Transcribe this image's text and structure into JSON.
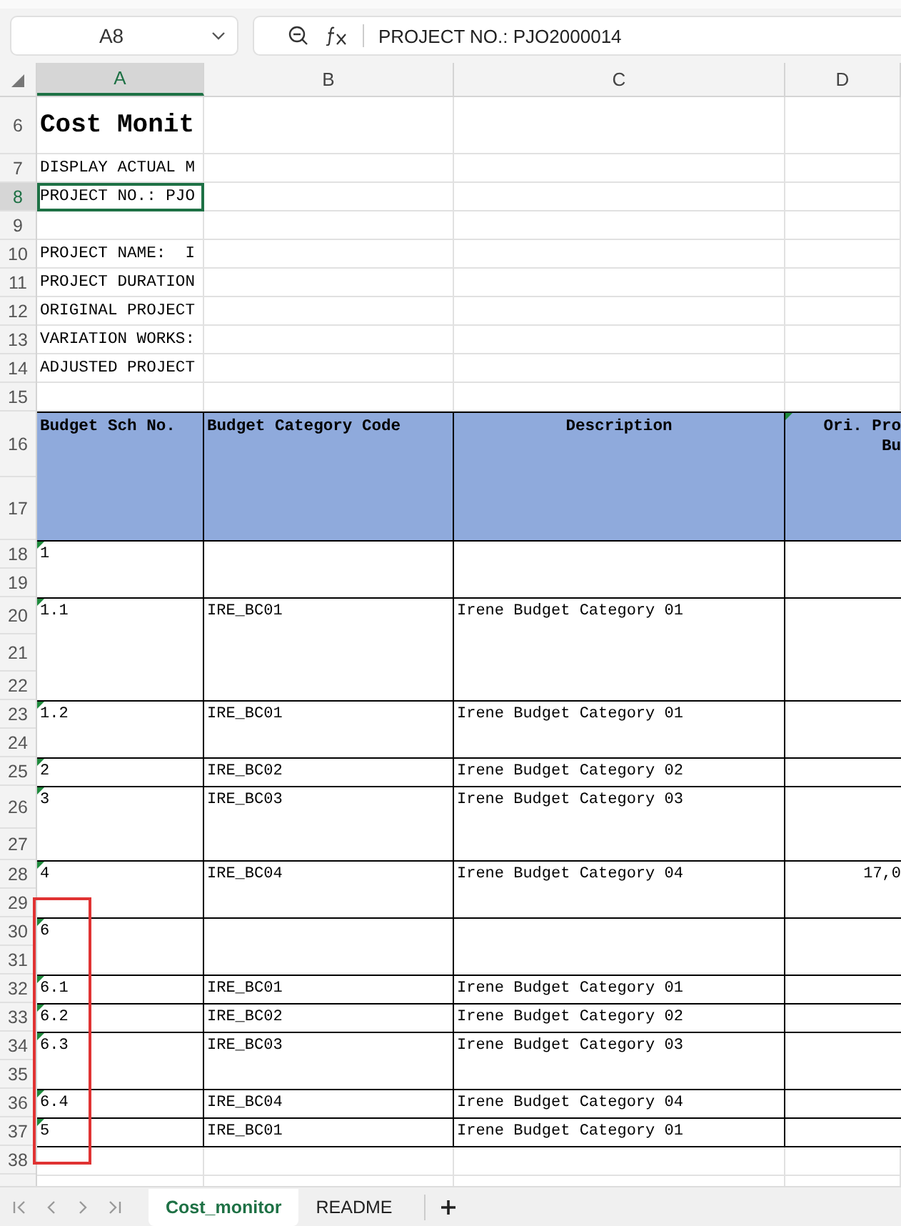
{
  "name_box": {
    "value": "A8"
  },
  "formula_bar": {
    "formula": "PROJECT NO.: PJO2000014"
  },
  "columns": [
    {
      "label": "A",
      "selected": true
    },
    {
      "label": "B",
      "selected": false
    },
    {
      "label": "C",
      "selected": false
    },
    {
      "label": "D",
      "selected": false
    }
  ],
  "row_headers": [
    {
      "label": "6",
      "selected": false
    },
    {
      "label": "7",
      "selected": false
    },
    {
      "label": "8",
      "selected": true
    },
    {
      "label": "9",
      "selected": false
    },
    {
      "label": "10",
      "selected": false
    },
    {
      "label": "11",
      "selected": false
    },
    {
      "label": "12",
      "selected": false
    },
    {
      "label": "13",
      "selected": false
    },
    {
      "label": "14",
      "selected": false
    },
    {
      "label": "15",
      "selected": false
    },
    {
      "label": "16",
      "selected": false
    },
    {
      "label": "17",
      "selected": false
    },
    {
      "label": "18",
      "selected": false
    },
    {
      "label": "19",
      "selected": false
    },
    {
      "label": "20",
      "selected": false
    },
    {
      "label": "21",
      "selected": false
    },
    {
      "label": "22",
      "selected": false
    },
    {
      "label": "23",
      "selected": false
    },
    {
      "label": "24",
      "selected": false
    },
    {
      "label": "25",
      "selected": false
    },
    {
      "label": "26",
      "selected": false
    },
    {
      "label": "27",
      "selected": false
    },
    {
      "label": "28",
      "selected": false
    },
    {
      "label": "29",
      "selected": false
    },
    {
      "label": "30",
      "selected": false
    },
    {
      "label": "31",
      "selected": false
    },
    {
      "label": "32",
      "selected": false
    },
    {
      "label": "33",
      "selected": false
    },
    {
      "label": "34",
      "selected": false
    },
    {
      "label": "35",
      "selected": false
    },
    {
      "label": "36",
      "selected": false
    },
    {
      "label": "37",
      "selected": false
    },
    {
      "label": "38",
      "selected": false
    }
  ],
  "info_cells": [
    {
      "text": "Cost Monit",
      "kind": "title",
      "selected": false
    },
    {
      "text": "DISPLAY ACTUAL M",
      "kind": "text",
      "selected": false
    },
    {
      "text": "PROJECT NO.: PJO",
      "kind": "text",
      "selected": true
    },
    {
      "selected": false
    },
    {
      "text": "PROJECT NAME:  I",
      "kind": "text",
      "selected": false
    },
    {
      "text": "PROJECT DURATION",
      "kind": "text",
      "selected": false
    },
    {
      "text": "ORIGINAL PROJECT",
      "kind": "text",
      "selected": false
    },
    {
      "text": "VARIATION WORKS:",
      "kind": "text",
      "selected": false
    },
    {
      "text": "ADJUSTED PROJECT",
      "kind": "text",
      "selected": false
    },
    {
      "selected": false
    }
  ],
  "table": {
    "headers": [
      {
        "lines": [
          "Budget Sch No."
        ],
        "flagged": false
      },
      {
        "lines": [
          "Budget Category Code"
        ],
        "flagged": false
      },
      {
        "lines": [
          "Description"
        ],
        "flagged": false
      },
      {
        "lines": [
          "Ori. Pro",
          "Bu"
        ],
        "flagged": true
      }
    ],
    "rows": [
      {
        "sch_no": "1",
        "flagged": true
      },
      {
        "sch_no": "1.1",
        "category_code": "IRE_BC01",
        "description": "Irene Budget Category 01",
        "flagged": true
      },
      {
        "sch_no": "1.2",
        "category_code": "IRE_BC01",
        "description": "Irene Budget Category 01",
        "flagged": true
      },
      {
        "sch_no": "2",
        "category_code": "IRE_BC02",
        "description": "Irene Budget Category 02",
        "flagged": true
      },
      {
        "sch_no": "3",
        "category_code": "IRE_BC03",
        "description": "Irene Budget Category 03",
        "flagged": true
      },
      {
        "sch_no": "4",
        "category_code": "IRE_BC04",
        "description": "Irene Budget Category 04",
        "ori_budget": "17,0",
        "flagged": true
      },
      {
        "sch_no": "6",
        "flagged": true
      },
      {
        "sch_no": "6.1",
        "category_code": "IRE_BC01",
        "description": "Irene Budget Category 01",
        "flagged": true
      },
      {
        "sch_no": "6.2",
        "category_code": "IRE_BC02",
        "description": "Irene Budget Category 02",
        "flagged": true
      },
      {
        "sch_no": "6.3",
        "category_code": "IRE_BC03",
        "description": "Irene Budget Category 03",
        "flagged": true
      },
      {
        "sch_no": "6.4",
        "category_code": "IRE_BC04",
        "description": "Irene Budget Category 04",
        "flagged": true
      },
      {
        "sch_no": "5",
        "category_code": "IRE_BC01",
        "description": "Irene Budget Category 01",
        "flagged": true
      }
    ]
  },
  "sheet_tabs": [
    {
      "label": "Cost_monitor",
      "selected": true
    },
    {
      "label": "README",
      "selected": false
    }
  ]
}
